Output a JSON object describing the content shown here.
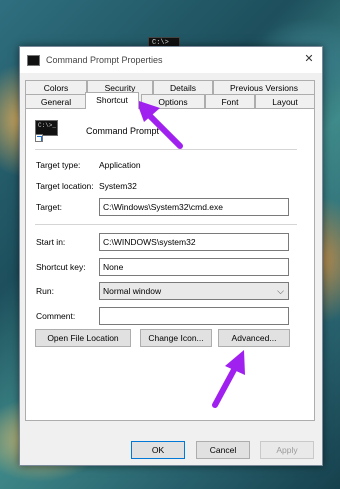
{
  "desktop": {
    "icon_text": "C:\\>"
  },
  "dialog": {
    "title": "Command Prompt Properties",
    "close_glyph": "✕",
    "tabs_row1": [
      "Colors",
      "Security",
      "Details",
      "Previous Versions"
    ],
    "tabs_row2": [
      "General",
      "Shortcut",
      "Options",
      "Font",
      "Layout"
    ],
    "active_tab": "Shortcut",
    "app_name": "Command Prompt",
    "icon_prompt": "C:\\>_",
    "target_type": {
      "label": "Target type:",
      "value": "Application"
    },
    "target_location": {
      "label": "Target location:",
      "value": "System32"
    },
    "target": {
      "label": "Target:",
      "value": "C:\\Windows\\System32\\cmd.exe"
    },
    "start_in": {
      "label": "Start in:",
      "value": "C:\\WINDOWS\\system32"
    },
    "shortcut_key": {
      "label": "Shortcut key:",
      "value": "None"
    },
    "run": {
      "label": "Run:",
      "value": "Normal window",
      "caret": "⌵"
    },
    "comment": {
      "label": "Comment:",
      "value": ""
    },
    "buttons": {
      "open_file_location": "Open File Location",
      "change_icon": "Change Icon...",
      "advanced": "Advanced..."
    },
    "footer": {
      "ok": "OK",
      "cancel": "Cancel",
      "apply": "Apply"
    }
  },
  "annotations": {
    "arrow_color": "#a020f0"
  },
  "colors": {
    "default_button_border": "#0078d7",
    "panel_bg": "#ffffff",
    "dialog_bg": "#f0f0f0"
  }
}
